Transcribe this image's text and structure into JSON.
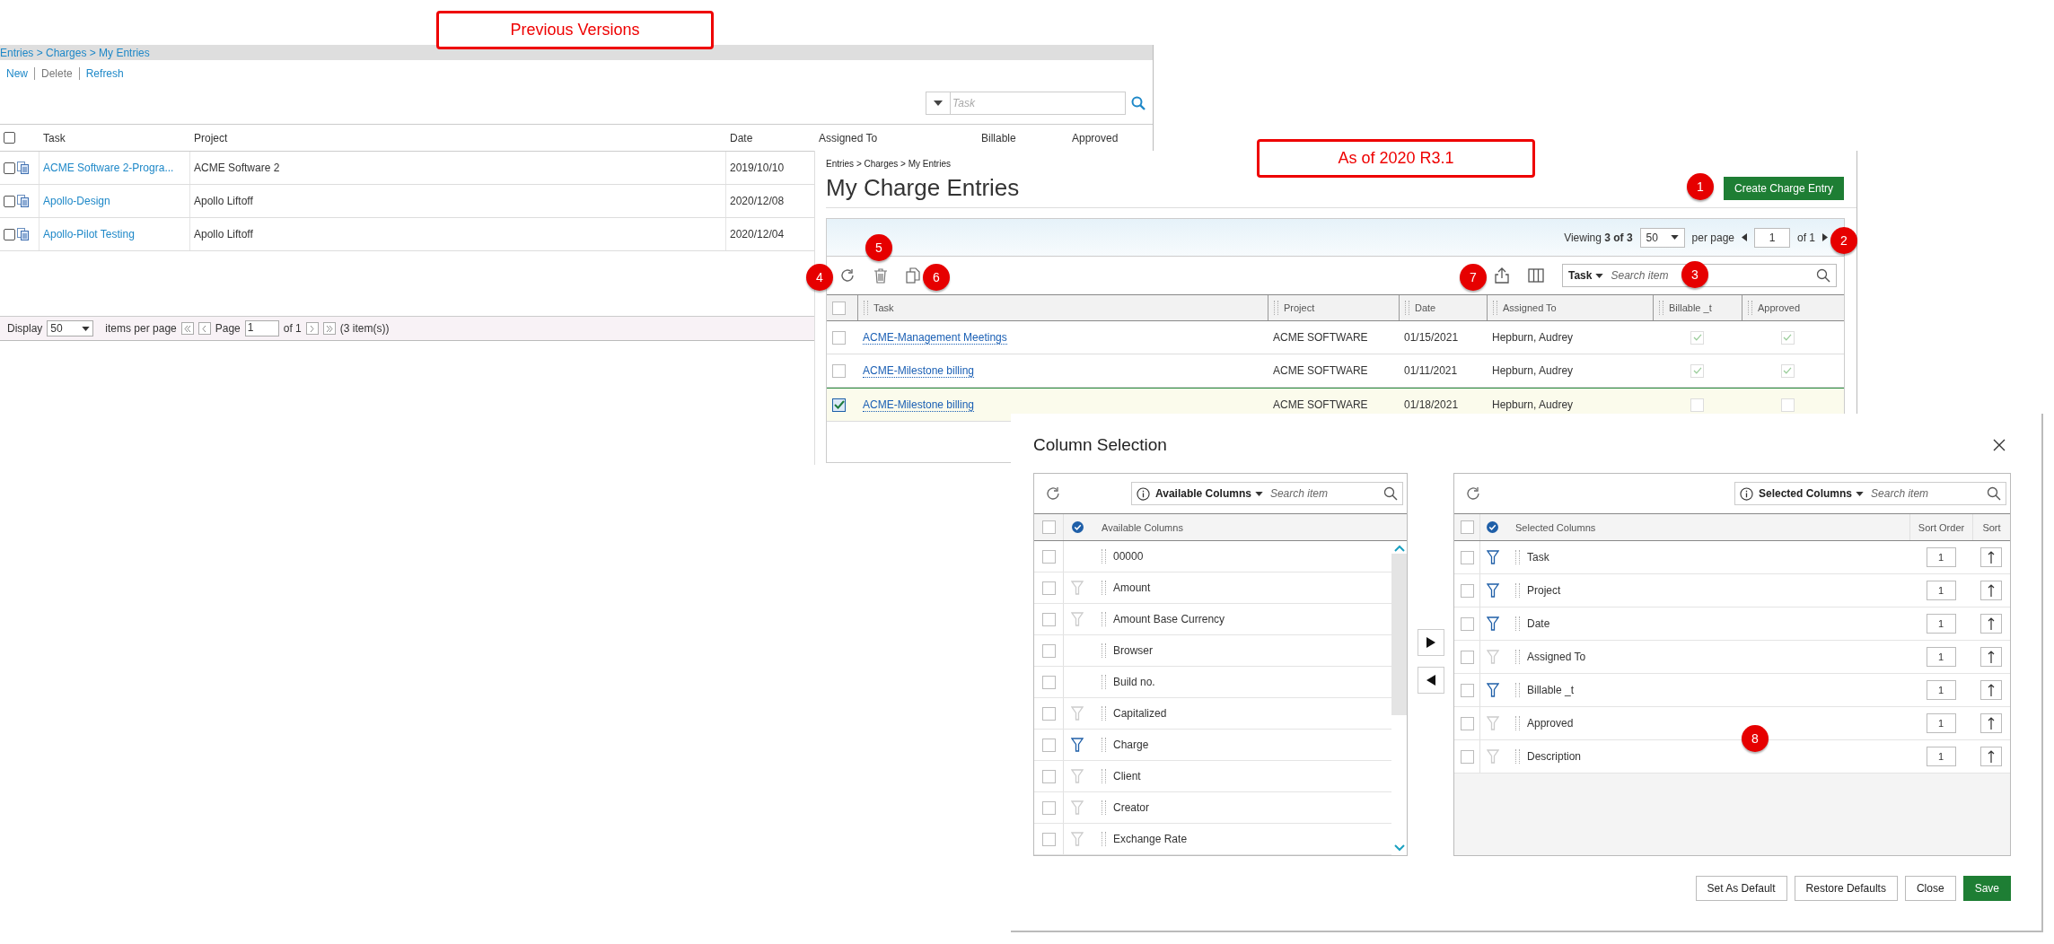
{
  "annotations": [
    {
      "label": "Previous Versions"
    },
    {
      "label": "As of 2020 R3.1"
    }
  ],
  "old_version": {
    "breadcrumb": "Entries > Charges > My Entries",
    "actions": [
      {
        "label": "New",
        "disabled": false
      },
      {
        "label": "Delete",
        "disabled": true
      },
      {
        "label": "Refresh",
        "disabled": false
      }
    ],
    "search": {
      "placeholder": "Task"
    },
    "select_all_checked": false,
    "columns": [
      "Task",
      "Project",
      "Date",
      "Assigned To",
      "Billable",
      "Approved"
    ],
    "rows": [
      {
        "task": "ACME Software 2-Progra...",
        "project": "ACME Software 2",
        "date": "2019/10/10",
        "checked": false
      },
      {
        "task": "Apollo-Design",
        "project": "Apollo Liftoff",
        "date": "2020/12/08",
        "checked": false
      },
      {
        "task": "Apollo-Pilot Testing",
        "project": "Apollo Liftoff",
        "date": "2020/12/04",
        "checked": false
      }
    ],
    "footer": {
      "display": "Display",
      "page_size": "50",
      "per_page": "items per page",
      "page": "Page",
      "page_value": "1",
      "of": "of 1",
      "count": "(3 item(s))"
    }
  },
  "new_version": {
    "breadcrumb": "Entries > Charges > My Entries",
    "title": "My Charge Entries",
    "create_button": "Create Charge Entry",
    "pager": {
      "viewing": "Viewing",
      "count": "3 of 3",
      "page_size": "50",
      "per_page": "per page",
      "page": "1",
      "of": "of 1"
    },
    "search": {
      "scope": "Task",
      "placeholder": "Search item"
    },
    "select_all_checked": false,
    "columns": [
      "Task",
      "Project",
      "Date",
      "Assigned To",
      "Billable _t",
      "Approved"
    ],
    "rows": [
      {
        "task": "ACME-Management Meetings",
        "project": "ACME SOFTWARE",
        "date": "01/15/2021",
        "assigned_to": "Hepburn, Audrey",
        "billable": true,
        "approved": true,
        "selected": false
      },
      {
        "task": "ACME-Milestone billing",
        "project": "ACME SOFTWARE",
        "date": "01/11/2021",
        "assigned_to": "Hepburn, Audrey",
        "billable": true,
        "approved": true,
        "selected": false
      },
      {
        "task": "ACME-Milestone billing",
        "project": "ACME SOFTWARE",
        "date": "01/18/2021",
        "assigned_to": "Hepburn, Audrey",
        "billable": false,
        "approved": false,
        "selected": true
      }
    ]
  },
  "dialog": {
    "title": "Column Selection",
    "available": {
      "scope": "Available Columns",
      "placeholder": "Search item",
      "header": "Available Columns",
      "select_all_checked": false,
      "items": [
        {
          "label": "00000",
          "kind": "plain",
          "checked": false
        },
        {
          "label": "Amount",
          "kind": "filter",
          "filter_active": false,
          "checked": false
        },
        {
          "label": "Amount Base Currency",
          "kind": "filter",
          "filter_active": false,
          "checked": false
        },
        {
          "label": "Browser",
          "kind": "plain",
          "checked": false
        },
        {
          "label": "Build no.",
          "kind": "plain",
          "checked": false
        },
        {
          "label": "Capitalized",
          "kind": "filter",
          "filter_active": false,
          "checked": false
        },
        {
          "label": "Charge",
          "kind": "filter",
          "filter_active": true,
          "checked": false
        },
        {
          "label": "Client",
          "kind": "filter",
          "filter_active": false,
          "checked": false
        },
        {
          "label": "Creator",
          "kind": "filter",
          "filter_active": false,
          "checked": false
        },
        {
          "label": "Exchange Rate",
          "kind": "filter",
          "filter_active": false,
          "checked": false
        }
      ]
    },
    "selected": {
      "scope": "Selected Columns",
      "placeholder": "Search item",
      "header": "Selected Columns",
      "sort_order_header": "Sort Order",
      "sort_header": "Sort",
      "select_all_checked": false,
      "items": [
        {
          "label": "Task",
          "kind": "filter",
          "filter_active": true,
          "checked": false,
          "sort_order": "1"
        },
        {
          "label": "Project",
          "kind": "filter",
          "filter_active": true,
          "checked": false,
          "sort_order": "1"
        },
        {
          "label": "Date",
          "kind": "filter",
          "filter_active": true,
          "checked": false,
          "sort_order": "1"
        },
        {
          "label": "Assigned To",
          "kind": "filter",
          "filter_active": false,
          "checked": false,
          "sort_order": "1"
        },
        {
          "label": "Billable _t",
          "kind": "filter",
          "filter_active": true,
          "checked": false,
          "sort_order": "1"
        },
        {
          "label": "Approved",
          "kind": "filter",
          "filter_active": false,
          "checked": false,
          "sort_order": "1"
        },
        {
          "label": "Description",
          "kind": "filter",
          "filter_active": false,
          "checked": false,
          "sort_order": "1"
        }
      ]
    },
    "buttons": [
      {
        "label": "Set As Default",
        "primary": false
      },
      {
        "label": "Restore Defaults",
        "primary": false
      },
      {
        "label": "Close",
        "primary": false
      },
      {
        "label": "Save",
        "primary": true
      }
    ]
  },
  "badges": [
    "1",
    "2",
    "5",
    "4",
    "6",
    "7",
    "3",
    "8"
  ]
}
